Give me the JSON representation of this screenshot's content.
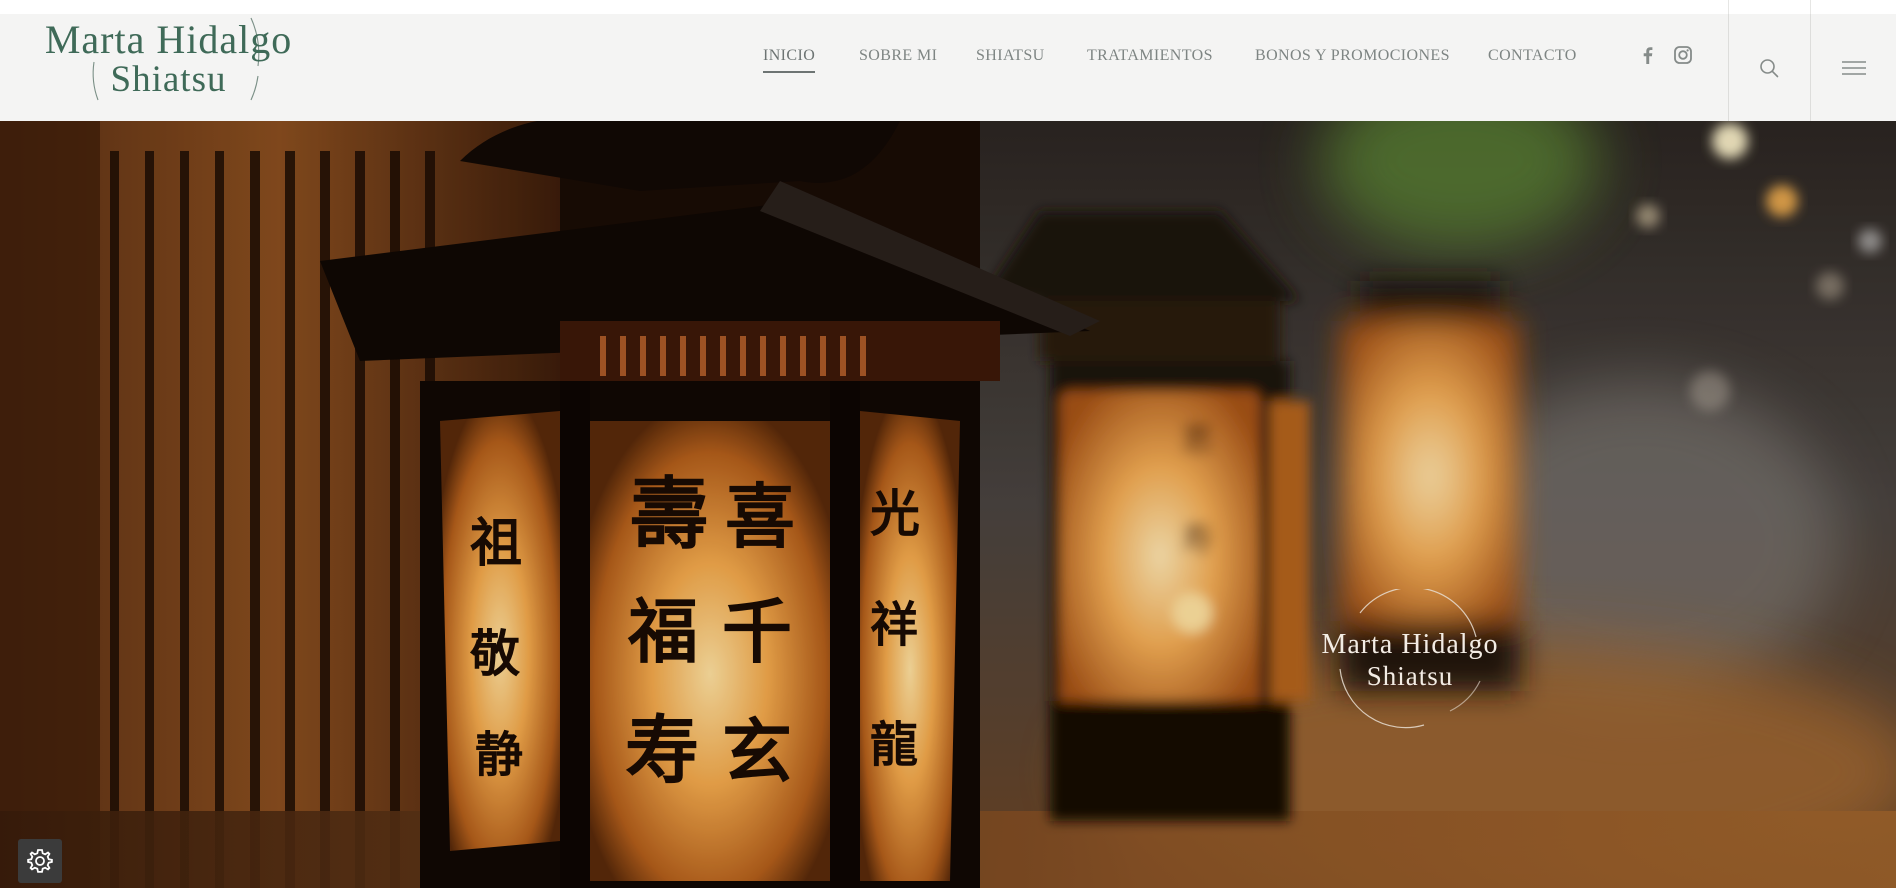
{
  "brand": {
    "line1": "Marta Hidalgo",
    "line2": "Shiatsu",
    "color": "#3f6a58"
  },
  "nav": {
    "items": [
      {
        "label": "INICIO",
        "active": true
      },
      {
        "label": "SOBRE MI",
        "active": false
      },
      {
        "label": "SHIATSU",
        "active": false
      },
      {
        "label": "TRATAMIENTOS",
        "active": false
      },
      {
        "label": "BONOS Y PROMOCIONES",
        "active": false
      },
      {
        "label": "CONTACTO",
        "active": false
      }
    ],
    "text_color": "#7e8583"
  },
  "social": {
    "icons": [
      "facebook-icon",
      "instagram-icon"
    ]
  },
  "header_icons": [
    "search-icon",
    "hamburger-menu-icon"
  ],
  "hero": {
    "logo_line1": "Marta Hidalgo",
    "logo_line2": "Shiatsu",
    "image_subject": "japanese-paper-lanterns-with-calligraphy"
  },
  "floating": {
    "icon": "gear-icon"
  }
}
